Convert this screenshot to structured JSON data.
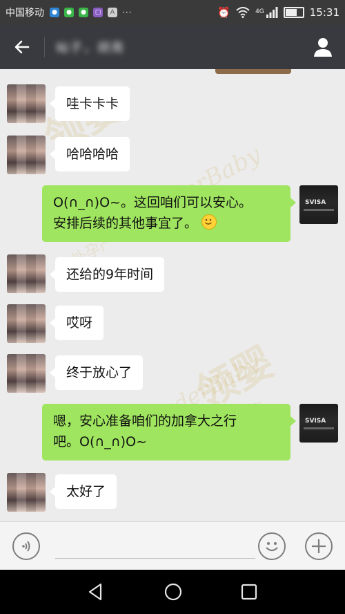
{
  "status_bar": {
    "carrier": "中国移动",
    "network": "4G",
    "time": "15:31",
    "battery_level": 0.7
  },
  "title_bar": {
    "contact_name": "屾子，胡南"
  },
  "messages": [
    {
      "side": "in",
      "text": "哇卡卡卡"
    },
    {
      "side": "in",
      "text": "哈哈哈哈"
    },
    {
      "side": "out",
      "lines": [
        "O(∩_∩)O~。这回咱们可以安心。",
        "安排后续的其他事宜了。"
      ],
      "emoji": "smile-emoji"
    },
    {
      "side": "in",
      "text": "还给的9年时间"
    },
    {
      "side": "in",
      "text": "哎呀"
    },
    {
      "side": "in",
      "text": "终于放心了"
    },
    {
      "side": "out",
      "lines": [
        "嗯，安心准备咱们的加拿大之行",
        "吧。O(∩_∩)O~"
      ]
    },
    {
      "side": "in",
      "text": "太好了"
    }
  ],
  "my_avatar_logo": "SVISA",
  "watermark": {
    "text": "LeaderBaby",
    "brand": "领婴",
    "tagline": "海外孕产"
  },
  "colors": {
    "status_bar": "#3a3a3a",
    "title_bar": "#393a3f",
    "chat_bg": "#ececec",
    "incoming_bubble": "#ffffff",
    "outgoing_bubble": "#9fe55f"
  },
  "icons": {
    "back": "back-arrow-icon",
    "profile": "user-icon",
    "voice": "voice-icon",
    "emoji": "emoji-icon",
    "more": "plus-icon",
    "nav_back": "triangle-back-icon",
    "nav_home": "circle-home-icon",
    "nav_recent": "square-recent-icon"
  }
}
